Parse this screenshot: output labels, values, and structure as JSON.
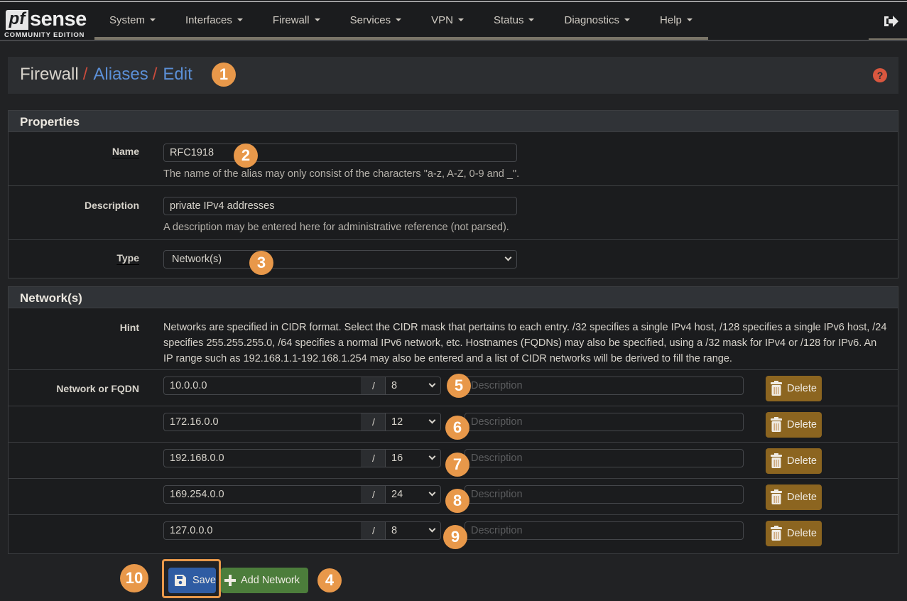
{
  "brand": {
    "logo_mark": "pf",
    "logo_word": "sense",
    "edition": "COMMUNITY EDITION"
  },
  "nav": {
    "items": [
      {
        "label": "System",
        "icon": "caret-down-icon"
      },
      {
        "label": "Interfaces",
        "icon": "caret-down-icon"
      },
      {
        "label": "Firewall",
        "icon": "caret-down-icon"
      },
      {
        "label": "Services",
        "icon": "caret-down-icon"
      },
      {
        "label": "VPN",
        "icon": "caret-down-icon"
      },
      {
        "label": "Status",
        "icon": "caret-down-icon"
      },
      {
        "label": "Diagnostics",
        "icon": "caret-down-icon"
      },
      {
        "label": "Help",
        "icon": "caret-down-icon"
      }
    ],
    "logout_icon": "sign-out-icon"
  },
  "breadcrumb": {
    "items": [
      "Firewall",
      "Aliases",
      "Edit"
    ],
    "separator": "/",
    "help_icon": "question-circle-icon",
    "help_glyph": "?"
  },
  "properties": {
    "heading": "Properties",
    "name": {
      "label": "Name",
      "value": "RFC1918",
      "help": "The name of the alias may only consist of the characters \"a-z, A-Z, 0-9 and _\"."
    },
    "description": {
      "label": "Description",
      "value": "private IPv4 addresses",
      "help": "A description may be entered here for administrative reference (not parsed)."
    },
    "type": {
      "label": "Type",
      "value": "Network(s)"
    }
  },
  "networks": {
    "heading": "Network(s)",
    "hint_label": "Hint",
    "hint": "Networks are specified in CIDR format. Select the CIDR mask that pertains to each entry. /32 specifies a single IPv4 host, /128 specifies a single IPv6 host, /24 specifies 255.255.255.0, /64 specifies a normal IPv6 network, etc. Hostnames (FQDNs) may also be specified, using a /32 mask for IPv4 or /128 for IPv6. An IP range such as 192.168.1.1-192.168.1.254 may also be entered and a list of CIDR networks will be derived to fill the range.",
    "row_label": "Network or FQDN",
    "slash": "/",
    "description_placeholder": "Description",
    "delete_label": "Delete",
    "entries": [
      {
        "network": "10.0.0.0",
        "mask": "8",
        "description": ""
      },
      {
        "network": "172.16.0.0",
        "mask": "12",
        "description": ""
      },
      {
        "network": "192.168.0.0",
        "mask": "16",
        "description": ""
      },
      {
        "network": "169.254.0.0",
        "mask": "24",
        "description": ""
      },
      {
        "network": "127.0.0.0",
        "mask": "8",
        "description": ""
      }
    ]
  },
  "actions": {
    "save_label": "Save",
    "add_network_label": "Add Network"
  },
  "callouts": [
    "1",
    "2",
    "3",
    "4",
    "5",
    "6",
    "7",
    "8",
    "9",
    "10"
  ],
  "colors": {
    "accent_callout": "#e8984a",
    "save": "#2f5ca3",
    "add": "#4c7d3b",
    "delete": "#8c6520",
    "link": "#5b8fd6",
    "separator": "#c84b3c"
  }
}
